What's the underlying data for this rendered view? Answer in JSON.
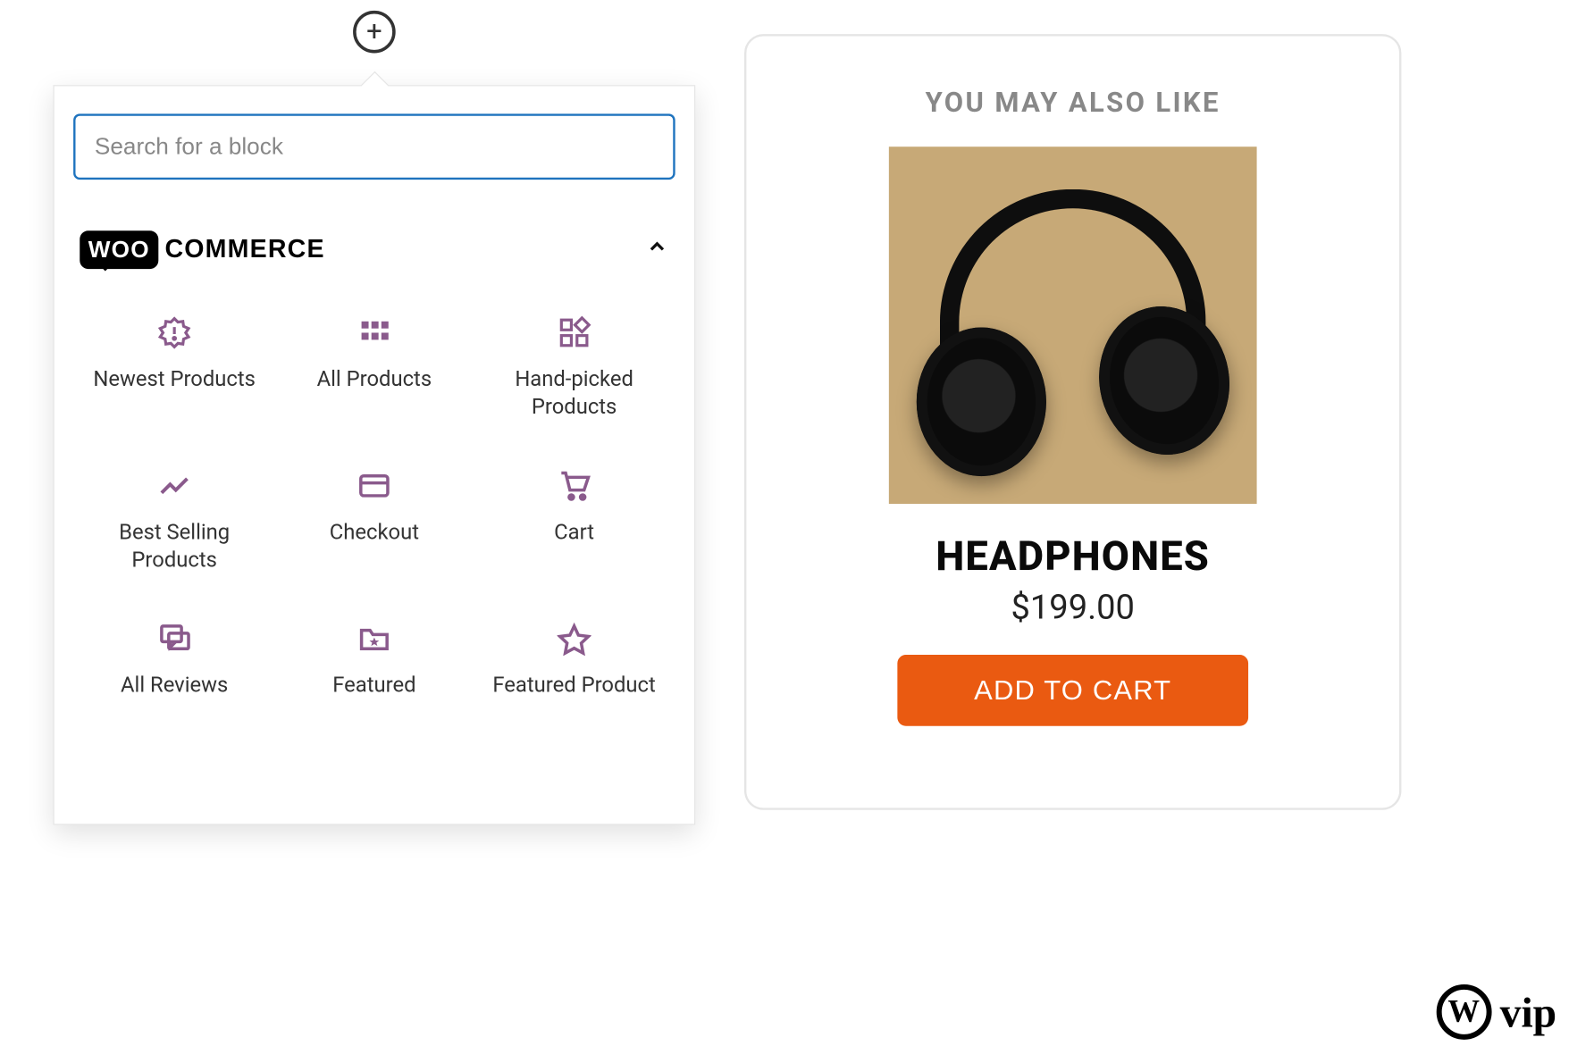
{
  "inserter": {
    "search_placeholder": "Search for a block",
    "category_label_woo": "WOO",
    "category_label_commerce": "COMMERCE",
    "blocks": [
      {
        "label": "Newest Products",
        "icon": "badge-icon"
      },
      {
        "label": "All Products",
        "icon": "grid-icon"
      },
      {
        "label": "Hand-picked Products",
        "icon": "squares-plus-icon"
      },
      {
        "label": "Best Selling Products",
        "icon": "trend-icon"
      },
      {
        "label": "Checkout",
        "icon": "card-icon"
      },
      {
        "label": "Cart",
        "icon": "cart-icon"
      },
      {
        "label": "All Reviews",
        "icon": "chat-icon"
      },
      {
        "label": "Featured",
        "icon": "folder-star-icon"
      },
      {
        "label": "Featured Product",
        "icon": "star-icon"
      }
    ]
  },
  "product_card": {
    "heading": "YOU MAY ALSO LIKE",
    "name": "HEADPHONES",
    "price": "$199.00",
    "button": "ADD TO CART"
  },
  "brand": {
    "w": "W",
    "vip": "vip"
  },
  "colors": {
    "accent": "#ea5a11",
    "icon": "#8a5a8c",
    "search_border": "#1e73be"
  }
}
